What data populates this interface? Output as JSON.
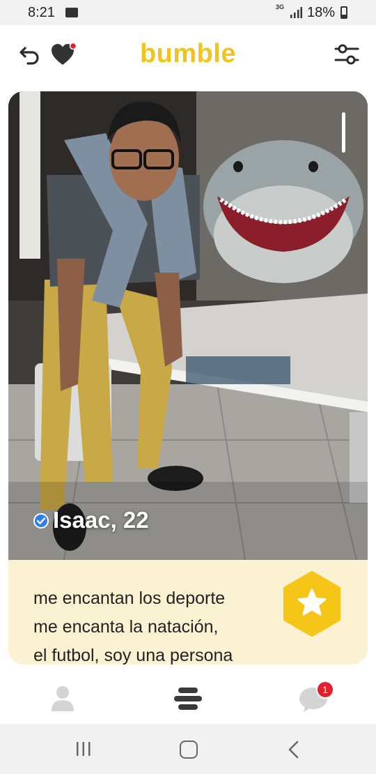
{
  "status_bar": {
    "time": "8:21",
    "network": "3G",
    "battery": "18%"
  },
  "header": {
    "logo": "bumble",
    "left_icons": [
      "undo-icon",
      "heart-icon"
    ],
    "right_icon": "filter-icon",
    "notification_dot_color": "#e0202a"
  },
  "profile": {
    "name_age": "Isaac, 22",
    "verified": true,
    "bio_lines": [
      "me encantan los deporte",
      "me encanta la natación,",
      "el futbol, soy una persona"
    ]
  },
  "bottom_nav": {
    "items": [
      "profile-icon",
      "discover-icon",
      "chat-icon"
    ],
    "chat_badge": "1"
  },
  "colors": {
    "brand": "#f0c419",
    "bio_background": "#fbf1d3",
    "badge": "#e0202a"
  }
}
